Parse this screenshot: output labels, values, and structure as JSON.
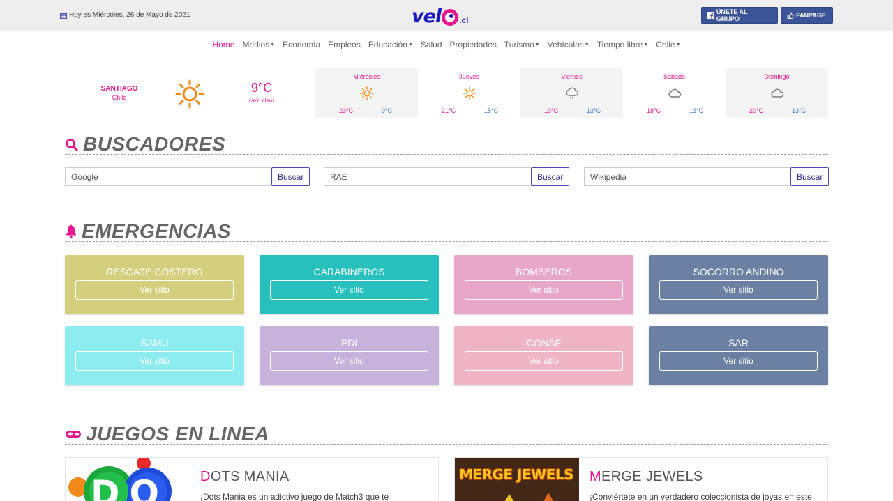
{
  "topbar": {
    "date": "Hoy es Miércoles, 26 de Mayo de 2021",
    "logo": {
      "word": "vel",
      "suffix": ".cl"
    },
    "group_button": "ÚNETE AL GRUPO",
    "fanpage_button": "FANPAGE"
  },
  "nav": [
    {
      "label": "Home",
      "active": true,
      "dropdown": false
    },
    {
      "label": "Medios",
      "dropdown": true
    },
    {
      "label": "Economía",
      "dropdown": false
    },
    {
      "label": "Empleos",
      "dropdown": false
    },
    {
      "label": "Educación",
      "dropdown": true
    },
    {
      "label": "Salud",
      "dropdown": false
    },
    {
      "label": "Propiedades",
      "dropdown": false
    },
    {
      "label": "Turismo",
      "dropdown": true
    },
    {
      "label": "Vehículos",
      "dropdown": true
    },
    {
      "label": "Tiempo libre",
      "dropdown": true
    },
    {
      "label": "Chile",
      "dropdown": true
    }
  ],
  "weather": {
    "city": "SANTIAGO",
    "country": "Chile",
    "temp": "9°C",
    "desc": "cielo claro",
    "icon": "sun-icon",
    "forecast": [
      {
        "day": "Miércoles",
        "hi": "23°C",
        "lo": "9°C",
        "icon": "sun-icon"
      },
      {
        "day": "Jueves",
        "hi": "21°C",
        "lo": "15°C",
        "icon": "sun-icon"
      },
      {
        "day": "Viernes",
        "hi": "19°C",
        "lo": "13°C",
        "icon": "rain-cloud-icon"
      },
      {
        "day": "Sábado",
        "hi": "18°C",
        "lo": "13°C",
        "icon": "cloud-icon"
      },
      {
        "day": "Domingo",
        "hi": "20°C",
        "lo": "13°C",
        "icon": "cloud-icon"
      }
    ]
  },
  "buscadores": {
    "title": "BUSCADORES",
    "fields": [
      {
        "placeholder": "Google",
        "button": "Buscar"
      },
      {
        "placeholder": "RAE",
        "button": "Buscar"
      },
      {
        "placeholder": "Wikipedia",
        "button": "Buscar"
      }
    ]
  },
  "emergencias": {
    "title": "EMERGENCIAS",
    "cards": [
      {
        "name": "RESCATE COSTERO",
        "button": "Ver sitio",
        "color": "#d4cf7d"
      },
      {
        "name": "CARABINEROS",
        "button": "Ver sitio",
        "color": "#27c0bd"
      },
      {
        "name": "BOMBEROS",
        "button": "Ver sitio",
        "color": "#e8a6c8"
      },
      {
        "name": "SOCORRO ANDINO",
        "button": "Ver sitio",
        "color": "#6b80a3"
      },
      {
        "name": "SAMU",
        "button": "Ver sitio",
        "color": "#8cecef"
      },
      {
        "name": "PDI",
        "button": "Ver sitio",
        "color": "#c7b2dc"
      },
      {
        "name": "CONAF",
        "button": "Ver sitio",
        "color": "#efb4c5"
      },
      {
        "name": "SAR",
        "button": "Ver sitio",
        "color": "#6b80a3"
      }
    ]
  },
  "juegos": {
    "title": "JUEGOS EN LINEA",
    "games": [
      {
        "first": "D",
        "rest": "OTS MANIA",
        "desc": "¡Dots Mania es un adictivo juego de Match3 que te",
        "thumb_text": "DO"
      },
      {
        "first": "M",
        "rest": "ERGE JEWELS",
        "desc": "¡Conviértete en un verdadero coleccionista de joyas en este",
        "thumb_text": "MERGE JEWELS"
      }
    ]
  },
  "colors": {
    "accent": "#e6168f",
    "brand": "#1b1bbf",
    "facebook": "#3b5498"
  }
}
